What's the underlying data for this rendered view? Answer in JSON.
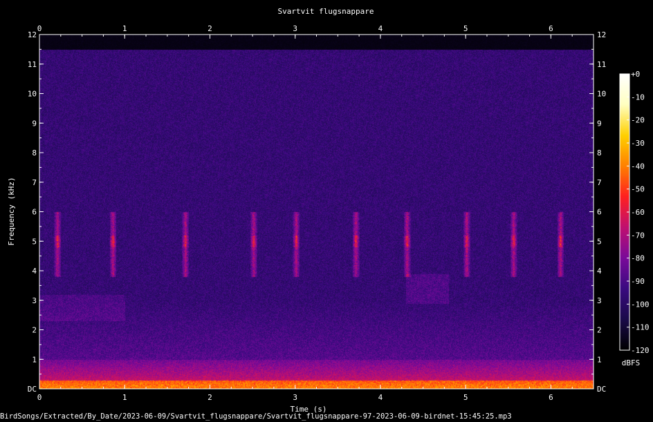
{
  "chart_data": {
    "type": "heatmap",
    "title": "Svartvit flugsnappare",
    "xlabel": "Time (s)",
    "ylabel": "Frequency (kHz)",
    "xlim": [
      0,
      6.5
    ],
    "ylim": [
      0,
      12
    ],
    "x_ticks": [
      "0",
      "1",
      "2",
      "3",
      "4",
      "5",
      "6"
    ],
    "y_ticks": [
      "DC",
      "1",
      "2",
      "3",
      "4",
      "5",
      "6",
      "7",
      "8",
      "9",
      "10",
      "11",
      "12"
    ],
    "colorbar": {
      "label": "dBFS",
      "ticks": [
        "+0",
        "-10",
        "-20",
        "-30",
        "-40",
        "-50",
        "-60",
        "-70",
        "-80",
        "-90",
        "-100",
        "-110",
        "-120"
      ],
      "range": [
        -120,
        0
      ],
      "colors": [
        "#000000",
        "#1a0a4a",
        "#3a0a80",
        "#7a0a9a",
        "#c01070",
        "#ff2020",
        "#ff8000",
        "#ffd000",
        "#ffffc0",
        "#ffffff"
      ]
    },
    "background_noise_ceiling_khz": 11.5,
    "song_events_s": [
      0.2,
      0.85,
      1.7,
      2.5,
      3.0,
      3.7,
      4.3,
      5.0,
      5.55,
      6.1
    ],
    "song_band_khz": [
      3.8,
      6.0
    ]
  },
  "filename": "BirdSongs/Extracted/By_Date/2023-06-09/Svartvit_flugsnappare/Svartvit_flugsnappare-97-2023-06-09-birdnet-15:45:25.mp3"
}
